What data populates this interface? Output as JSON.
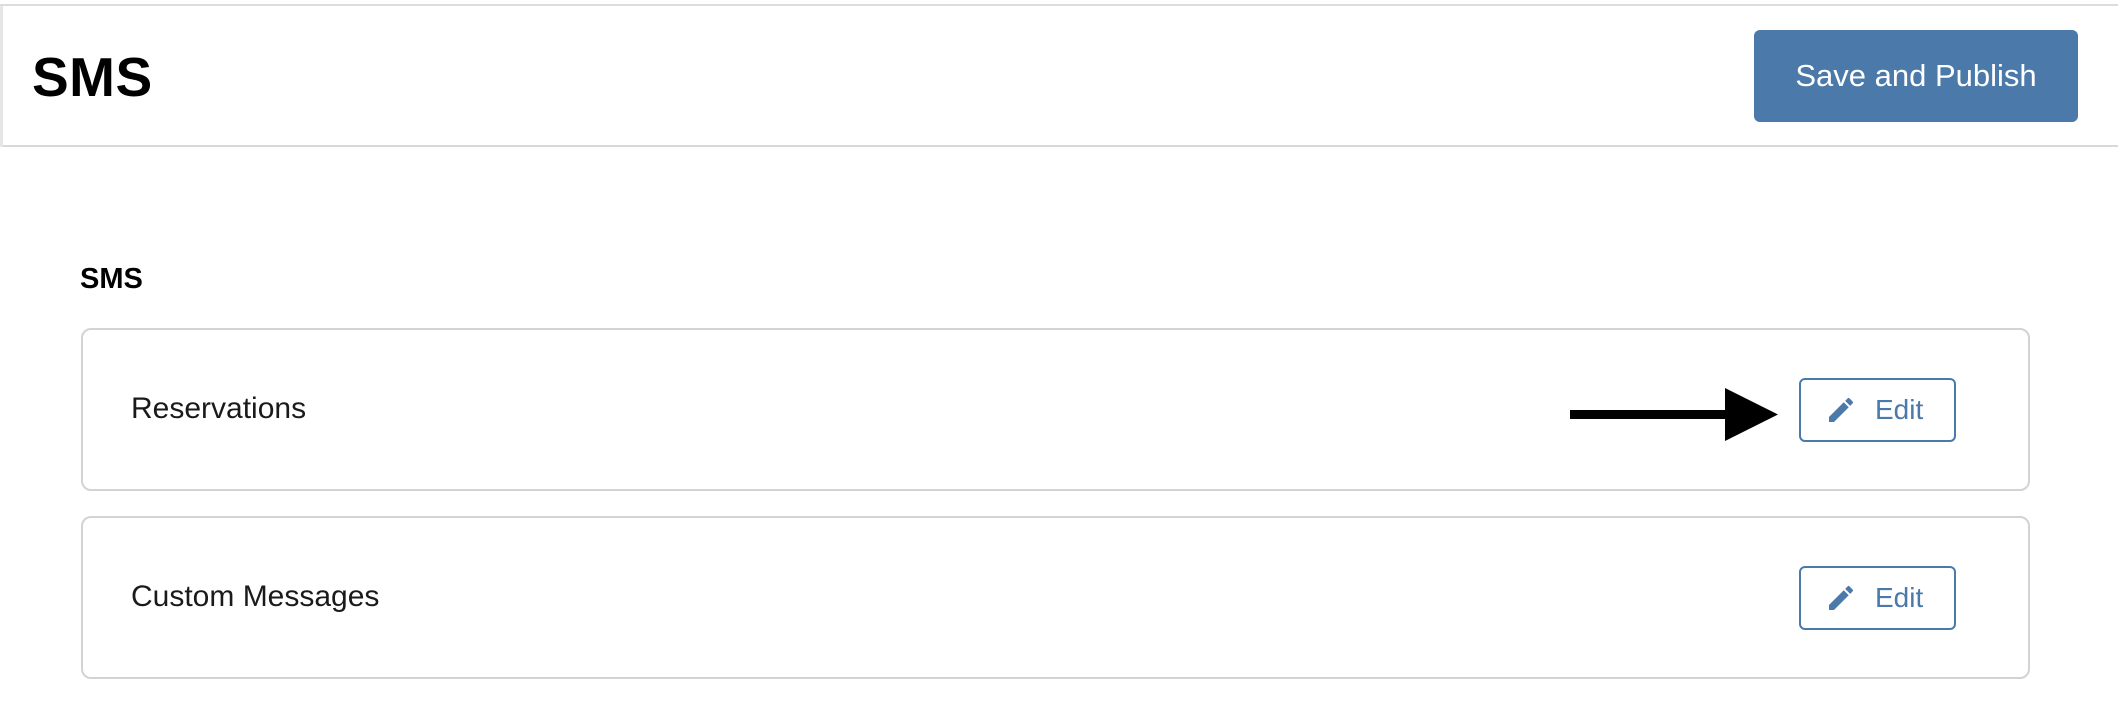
{
  "header": {
    "title": "SMS",
    "publish_label": "Save and Publish"
  },
  "section": {
    "title": "SMS",
    "items": [
      {
        "label": "Reservations",
        "edit_label": "Edit"
      },
      {
        "label": "Custom Messages",
        "edit_label": "Edit"
      }
    ]
  },
  "colors": {
    "accent": "#4a79aa",
    "border": "#d3d3d3"
  },
  "icons": {
    "edit": "pencil-icon",
    "annotation": "arrow-right-icon"
  }
}
